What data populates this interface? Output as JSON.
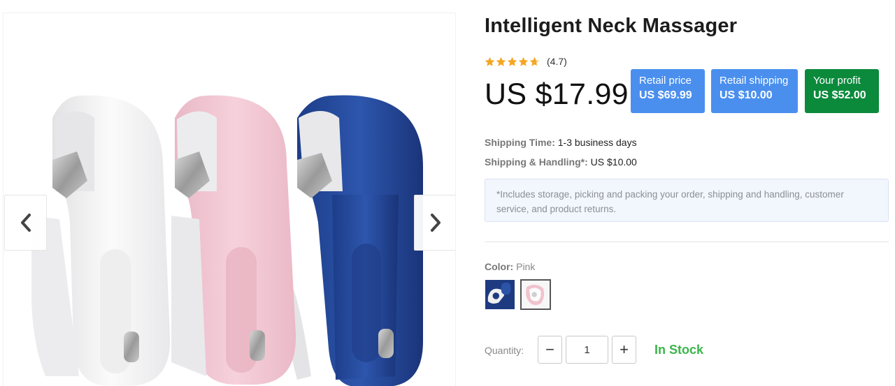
{
  "product": {
    "title": "Intelligent Neck Massager",
    "rating": {
      "stars": 4.7,
      "label": "(4.7)"
    },
    "price": "US $17.99",
    "badges": {
      "retail_price": {
        "label": "Retail price",
        "value": "US $69.99",
        "color": "#4a8fee"
      },
      "retail_shipping": {
        "label": "Retail shipping",
        "value": "US $10.00",
        "color": "#4a8fee"
      },
      "your_profit": {
        "label": "Your profit",
        "value": "US $52.00",
        "color": "#0b8a3c"
      }
    },
    "shipping_time": {
      "label": "Shipping Time:",
      "value": "1-3 business days"
    },
    "shipping_handling": {
      "label": "Shipping & Handling*:",
      "value": "US $10.00"
    },
    "note": "*Includes storage, picking and packing your order, shipping and handling, customer service, and product returns.",
    "color": {
      "label": "Color:",
      "selected": "Pink",
      "options": [
        "Blue",
        "Pink"
      ]
    },
    "quantity": {
      "label": "Quantity:",
      "value": "1",
      "minus": "−",
      "plus": "+"
    },
    "stock_status": {
      "text": "In Stock",
      "color": "#3bb54a"
    }
  },
  "gallery": {
    "prev_icon": "chevron-left-icon",
    "next_icon": "chevron-right-icon",
    "image": "neck-massagers-white-pink-blue"
  }
}
